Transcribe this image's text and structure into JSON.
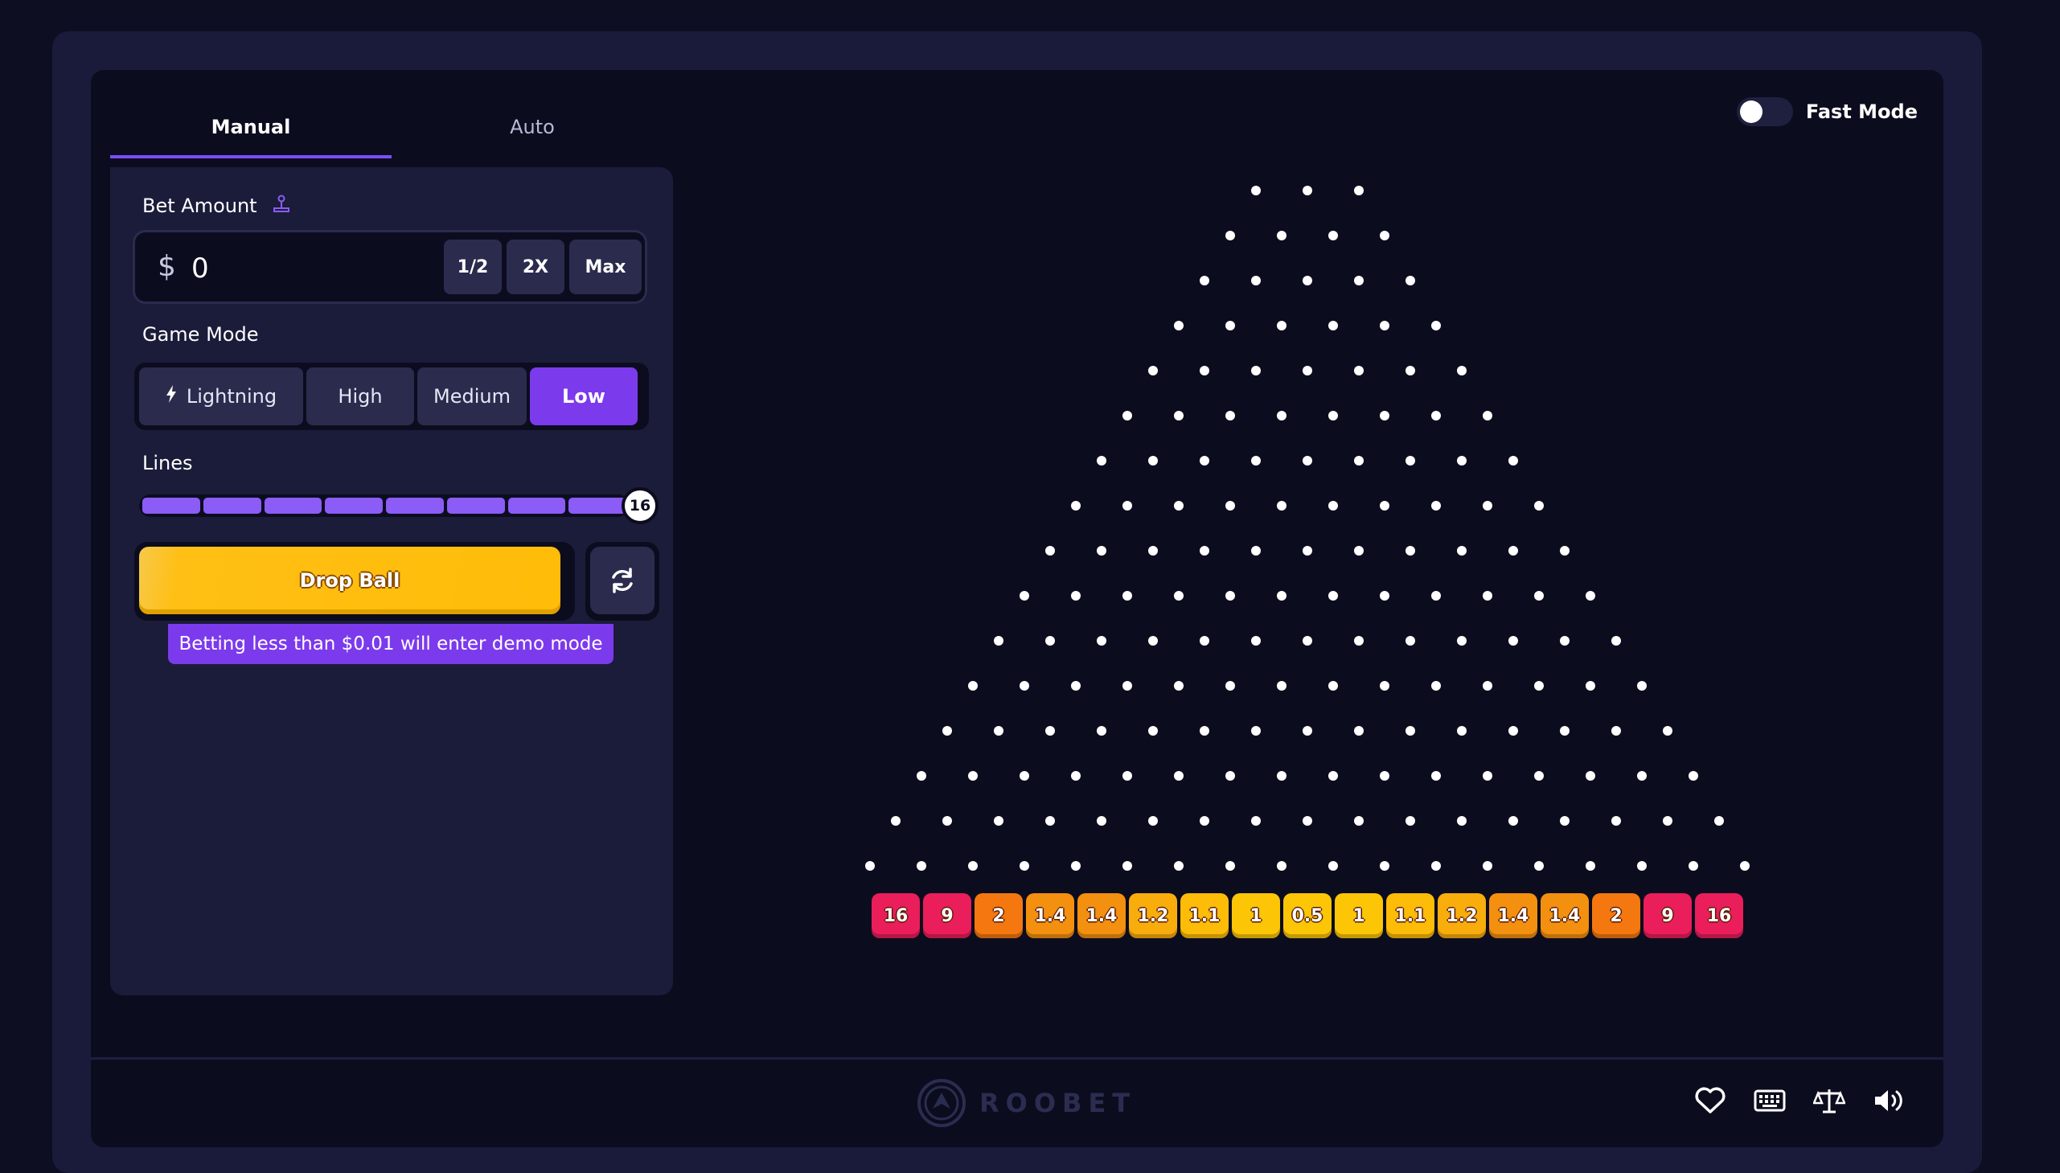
{
  "tabs": [
    {
      "label": "Manual",
      "active": true
    },
    {
      "label": "Auto",
      "active": false
    }
  ],
  "bet": {
    "label": "Bet Amount",
    "currency": "$",
    "value": "0",
    "half_label": "1/2",
    "double_label": "2X",
    "max_label": "Max"
  },
  "game_mode": {
    "label": "Game Mode",
    "options": [
      "Lightning",
      "High",
      "Medium",
      "Low"
    ],
    "selected": "Low"
  },
  "lines": {
    "label": "Lines",
    "value": "16"
  },
  "drop_button": "Drop Ball",
  "demo_note": "Betting less than $0.01 will enter demo mode",
  "fast_mode": {
    "label": "Fast Mode",
    "enabled": false
  },
  "multipliers": [
    "16",
    "9",
    "2",
    "1.4",
    "1.4",
    "1.2",
    "1.1",
    "1",
    "0.5",
    "1",
    "1.1",
    "1.2",
    "1.4",
    "1.4",
    "2",
    "9",
    "16"
  ],
  "bucket_colors": {
    "16": "#ea1e5a",
    "9": "#ea1e5a",
    "2": "#f4780f",
    "1.4": "#f4900f",
    "1.2": "#f9ad0c",
    "1.1": "#fcbc07",
    "1": "#fcc606",
    "0.5": "#fcc606"
  },
  "brand": "ROOBET",
  "footer_icons": [
    "heart-icon",
    "keyboard-icon",
    "scales-icon",
    "volume-icon"
  ],
  "colors": {
    "accent": "#7c3aed",
    "drop": "#ffbc08",
    "background": "#0c0c1f"
  }
}
